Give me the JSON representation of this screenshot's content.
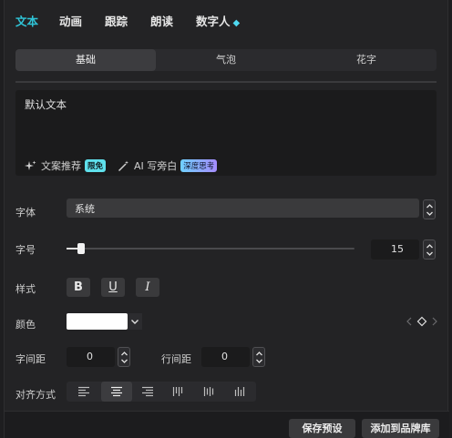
{
  "tabs": [
    {
      "label": "文本",
      "active": true
    },
    {
      "label": "动画",
      "active": false
    },
    {
      "label": "跟踪",
      "active": false
    },
    {
      "label": "朗读",
      "active": false
    },
    {
      "label": "数字人",
      "active": false,
      "icon": "diamond-icon"
    }
  ],
  "segments": [
    {
      "label": "基础",
      "active": true
    },
    {
      "label": "气泡",
      "active": false
    },
    {
      "label": "花字",
      "active": false
    }
  ],
  "textbox": {
    "value": "默认文本",
    "copy_recommend": {
      "label": "文案推荐",
      "badge": "限免",
      "icon": "sparkle-icon"
    },
    "ai_narration": {
      "label": "AI 写旁白",
      "badge": "深度思考",
      "icon": "magic-wand-icon"
    }
  },
  "font": {
    "label": "字体",
    "value": "系统"
  },
  "font_size": {
    "label": "字号",
    "value": "15",
    "slider_fraction": 0.05
  },
  "style": {
    "label": "样式",
    "bold": "B",
    "underline": "U",
    "italic": "I"
  },
  "color": {
    "label": "颜色",
    "value": "#ffffff"
  },
  "spacing": {
    "letter_label": "字间距",
    "letter_value": "0",
    "line_label": "行间距",
    "line_value": "0"
  },
  "alignment": {
    "label": "对齐方式",
    "options": [
      "align-left-icon",
      "align-center-icon",
      "align-right-icon",
      "vertical-top-icon",
      "vertical-center-icon",
      "vertical-bottom-icon"
    ],
    "active_index": 1
  },
  "footer": {
    "save_preset": "保存预设",
    "add_brand": "添加到品牌库"
  },
  "colors": {
    "accent": "#2fc3d6",
    "badge_free": "#5fe0ec"
  }
}
